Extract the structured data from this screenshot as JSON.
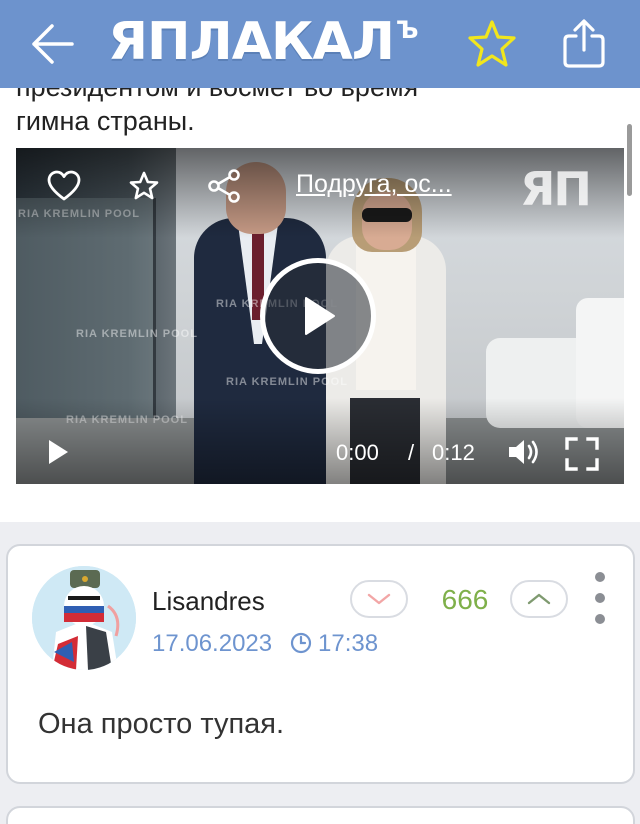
{
  "header": {
    "logo": "ЯПЛАКАЛ",
    "logo_suffix": "Ъ",
    "back_icon": "arrow-left-icon",
    "star_icon": "star-outline-icon",
    "share_icon": "share-icon"
  },
  "post": {
    "text_line1": "президентом и восмет во время",
    "text_line2": "гимна страны."
  },
  "video": {
    "title": "Подруга, ос...",
    "logo": "ЯП",
    "watermark": "RIA KREMLIN POOL",
    "current_time": "0:00",
    "separator": "/",
    "duration": "0:12",
    "icons": [
      "heart-icon",
      "star-icon",
      "share-icon",
      "play-icon",
      "volume-icon",
      "fullscreen-icon"
    ]
  },
  "comment": {
    "username": "Lisandres",
    "date": "17.06.2023",
    "time": "17:38",
    "score": "666",
    "text": "Она просто тупая."
  },
  "colors": {
    "header_bg": "#6d93cd",
    "date_blue": "#6e94cf",
    "score_green": "#7fb04a",
    "star_yellow": "#f1e61d"
  }
}
